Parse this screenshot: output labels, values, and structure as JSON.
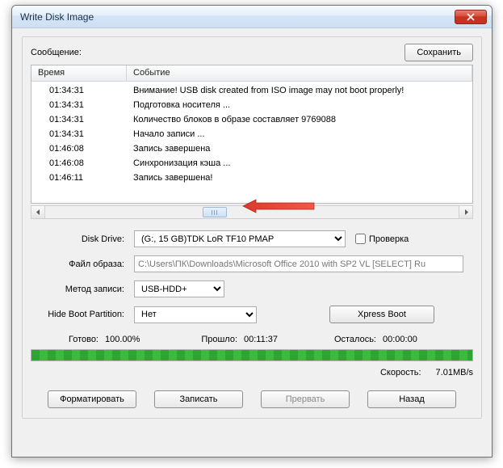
{
  "title": "Write Disk Image",
  "message_label": "Сообщение:",
  "save_btn": "Сохранить",
  "columns": {
    "time": "Время",
    "event": "Событие"
  },
  "log": [
    {
      "t": "01:34:31",
      "e": "Внимание! USB disk created from ISO image may not boot properly!"
    },
    {
      "t": "01:34:31",
      "e": "Подготовка носителя ..."
    },
    {
      "t": "01:34:31",
      "e": "Количество блоков в образе составляет 9769088"
    },
    {
      "t": "01:34:31",
      "e": "Начало записи ..."
    },
    {
      "t": "01:46:08",
      "e": "Запись завершена"
    },
    {
      "t": "01:46:08",
      "e": "Синхронизация кэша ..."
    },
    {
      "t": "01:46:11",
      "e": "Запись завершена!"
    }
  ],
  "labels": {
    "disk_drive": "Disk Drive:",
    "file": "Файл образа:",
    "method": "Метод записи:",
    "hide": "Hide Boot Partition:",
    "check": "Проверка",
    "xpress": "Xpress Boot",
    "ready": "Готово:",
    "elapsed": "Прошло:",
    "remain": "Осталось:",
    "speed": "Скорость:"
  },
  "values": {
    "disk_drive": "(G:, 15 GB)TDK LoR TF10            PMAP",
    "file": "C:\\Users\\ПК\\Downloads\\Microsoft Office 2010 with SP2 VL [SELECT] Ru",
    "method": "USB-HDD+",
    "hide": "Нет",
    "ready_pct": "100.00%",
    "elapsed": "00:11:37",
    "remain": "00:00:00",
    "speed_val": "7.01MB/s"
  },
  "buttons": {
    "format": "Форматировать",
    "write": "Записать",
    "abort": "Прервать",
    "back": "Назад"
  }
}
